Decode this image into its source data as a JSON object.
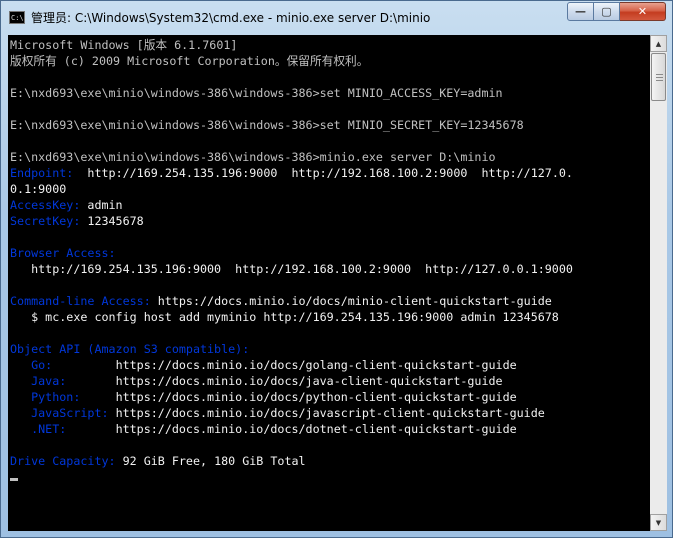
{
  "window": {
    "title": "管理员: C:\\Windows\\System32\\cmd.exe - minio.exe  server D:\\minio",
    "icon_text": "C:\\.",
    "controls": {
      "minimize": "—",
      "maximize": "▢",
      "close": "✕"
    }
  },
  "console": {
    "lines": [
      {
        "segments": [
          {
            "text": "Microsoft Windows [版本 6.1.7601]"
          }
        ]
      },
      {
        "segments": [
          {
            "text": "版权所有 (c) 2009 Microsoft Corporation。保留所有权利。"
          }
        ]
      },
      {
        "segments": [
          {
            "text": ""
          }
        ]
      },
      {
        "segments": [
          {
            "text": "E:\\nxd693\\exe\\minio\\windows-386\\windows-386>set MINIO_ACCESS_KEY=admin"
          }
        ]
      },
      {
        "segments": [
          {
            "text": ""
          }
        ]
      },
      {
        "segments": [
          {
            "text": "E:\\nxd693\\exe\\minio\\windows-386\\windows-386>set MINIO_SECRET_KEY=12345678"
          }
        ]
      },
      {
        "segments": [
          {
            "text": ""
          }
        ]
      },
      {
        "segments": [
          {
            "text": "E:\\nxd693\\exe\\minio\\windows-386\\windows-386>minio.exe server D:\\minio"
          }
        ]
      },
      {
        "segments": [
          {
            "text": "Endpoint:",
            "color": "blue"
          },
          {
            "text": "  http://169.254.135.196:9000  http://192.168.100.2:9000  http://127.0.",
            "color": "white"
          }
        ]
      },
      {
        "segments": [
          {
            "text": "0.1:9000",
            "color": "white"
          }
        ]
      },
      {
        "segments": [
          {
            "text": "AccessKey:",
            "color": "blue"
          },
          {
            "text": " admin",
            "color": "white"
          }
        ]
      },
      {
        "segments": [
          {
            "text": "SecretKey:",
            "color": "blue"
          },
          {
            "text": " 12345678",
            "color": "white"
          }
        ]
      },
      {
        "segments": [
          {
            "text": ""
          }
        ]
      },
      {
        "segments": [
          {
            "text": "Browser Access:",
            "color": "blue"
          }
        ]
      },
      {
        "segments": [
          {
            "text": "   http://169.254.135.196:9000  http://192.168.100.2:9000  http://127.0.0.1:9000",
            "color": "white"
          }
        ]
      },
      {
        "segments": [
          {
            "text": ""
          }
        ]
      },
      {
        "segments": [
          {
            "text": "Command-line Access:",
            "color": "blue"
          },
          {
            "text": " https://docs.minio.io/docs/minio-client-quickstart-guide",
            "color": "white"
          }
        ]
      },
      {
        "segments": [
          {
            "text": "   $ mc.exe config host add myminio http://169.254.135.196:9000 admin 12345678",
            "color": "white"
          }
        ]
      },
      {
        "segments": [
          {
            "text": ""
          }
        ]
      },
      {
        "segments": [
          {
            "text": "Object API (Amazon S3 compatible):",
            "color": "blue"
          }
        ]
      },
      {
        "segments": [
          {
            "text": "   Go:         ",
            "color": "blue"
          },
          {
            "text": "https://docs.minio.io/docs/golang-client-quickstart-guide",
            "color": "white"
          }
        ]
      },
      {
        "segments": [
          {
            "text": "   Java:       ",
            "color": "blue"
          },
          {
            "text": "https://docs.minio.io/docs/java-client-quickstart-guide",
            "color": "white"
          }
        ]
      },
      {
        "segments": [
          {
            "text": "   Python:     ",
            "color": "blue"
          },
          {
            "text": "https://docs.minio.io/docs/python-client-quickstart-guide",
            "color": "white"
          }
        ]
      },
      {
        "segments": [
          {
            "text": "   JavaScript: ",
            "color": "blue"
          },
          {
            "text": "https://docs.minio.io/docs/javascript-client-quickstart-guide",
            "color": "white"
          }
        ]
      },
      {
        "segments": [
          {
            "text": "   .NET:       ",
            "color": "blue"
          },
          {
            "text": "https://docs.minio.io/docs/dotnet-client-quickstart-guide",
            "color": "white"
          }
        ]
      },
      {
        "segments": [
          {
            "text": ""
          }
        ]
      },
      {
        "segments": [
          {
            "text": "Drive Capacity:",
            "color": "blue"
          },
          {
            "text": " 92 GiB Free, 180 GiB Total",
            "color": "white"
          }
        ]
      },
      {
        "segments": [
          {
            "text": ""
          }
        ]
      }
    ]
  },
  "colors": {
    "background": "#000000",
    "default": "#c0c0c0",
    "blue": "#0037da",
    "white": "#f2f2f2"
  }
}
